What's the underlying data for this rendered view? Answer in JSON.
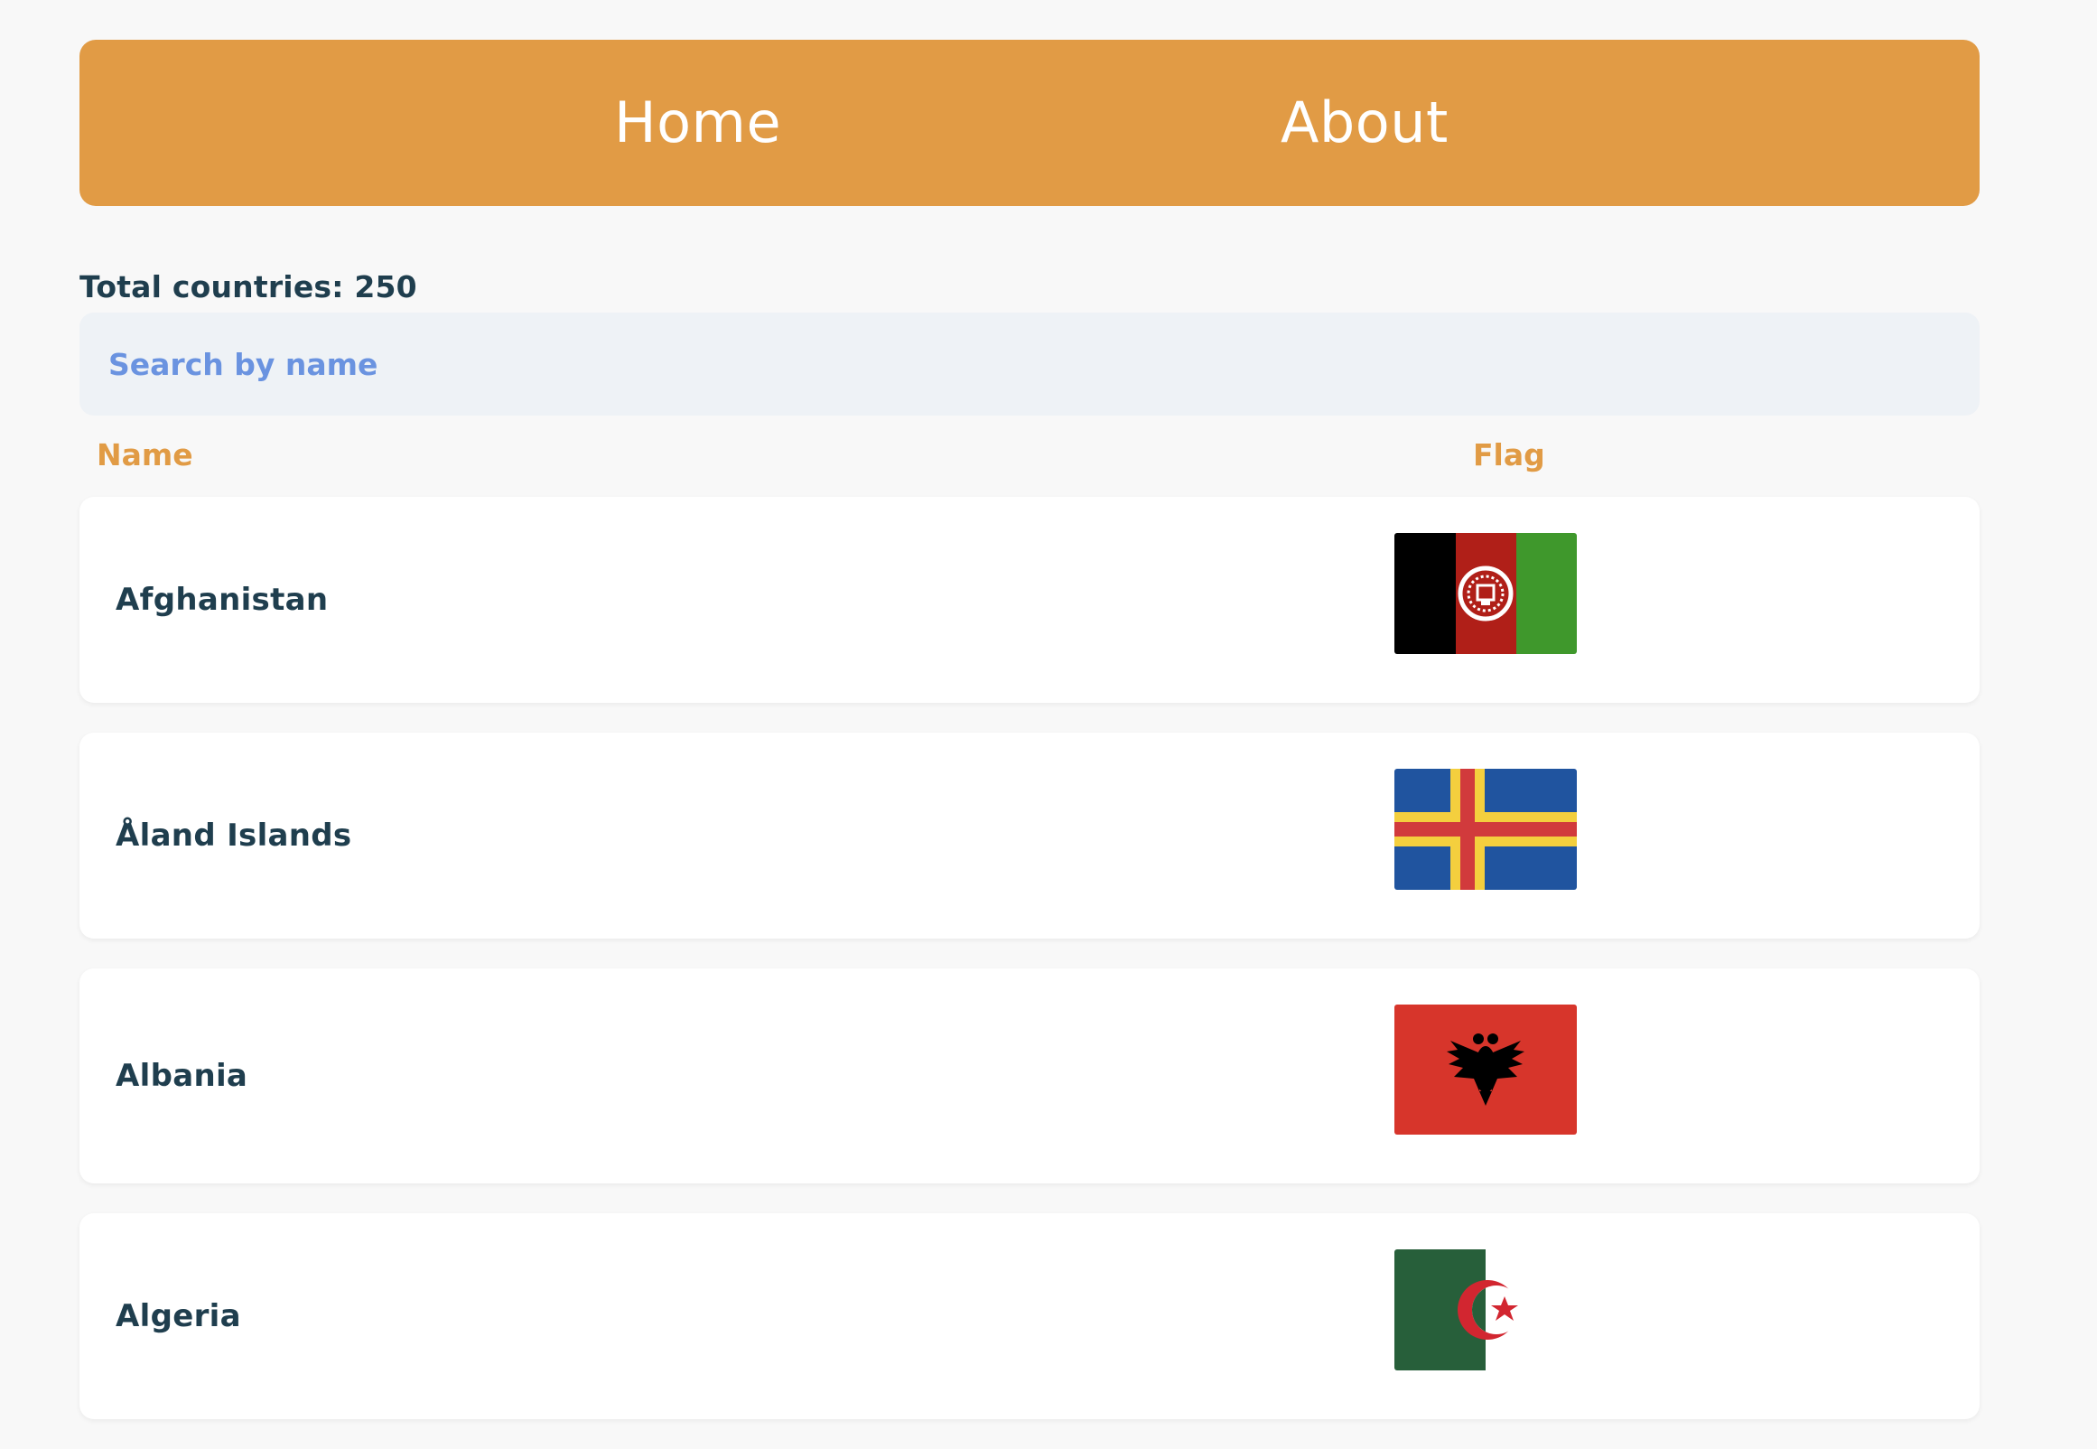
{
  "nav": {
    "home_label": "Home",
    "about_label": "About",
    "background": "#e19b45"
  },
  "total_label": "Total countries: 250",
  "search": {
    "placeholder": "Search by name",
    "value": ""
  },
  "table": {
    "headers": {
      "name": "Name",
      "flag": "Flag"
    },
    "rows": [
      {
        "name": "Afghanistan",
        "flag_icon": "afghanistan-flag-icon"
      },
      {
        "name": "Åland Islands",
        "flag_icon": "aland-islands-flag-icon"
      },
      {
        "name": "Albania",
        "flag_icon": "albania-flag-icon"
      },
      {
        "name": "Algeria",
        "flag_icon": "algeria-flag-icon"
      }
    ]
  },
  "colors": {
    "accent": "#e19b45",
    "text": "#1f3e4e",
    "placeholder": "#6a93e0",
    "search_bg": "#eef2f6",
    "page_bg": "#f8f8f8"
  }
}
